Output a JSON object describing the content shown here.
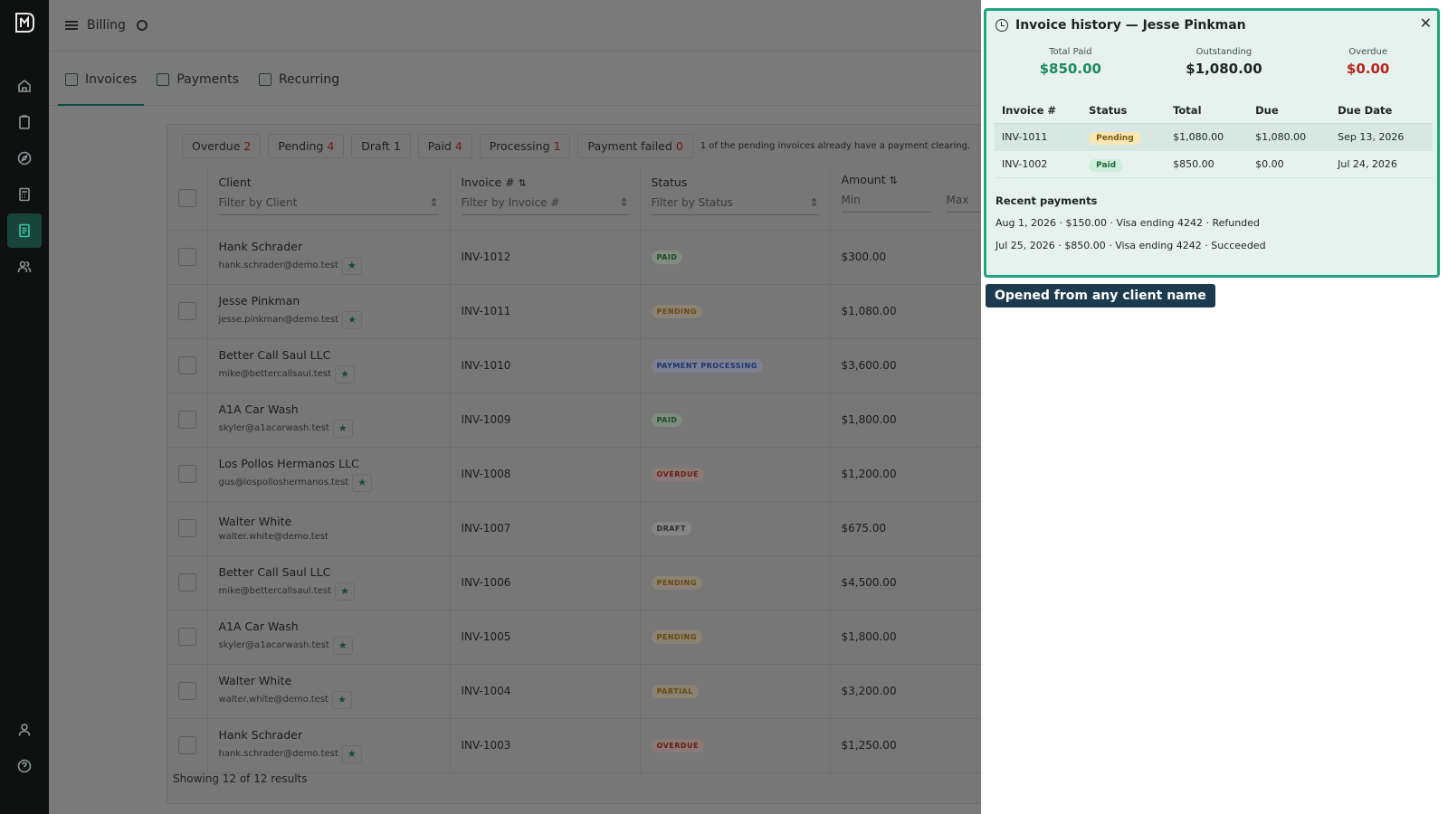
{
  "topbar": {
    "title": "Billing"
  },
  "tabs": [
    {
      "label": "Invoices",
      "active": true
    },
    {
      "label": "Payments",
      "active": false
    },
    {
      "label": "Recurring",
      "active": false
    }
  ],
  "filters": {
    "chips": [
      {
        "label": "Overdue",
        "count": "2"
      },
      {
        "label": "Pending",
        "count": "4"
      },
      {
        "label": "Draft",
        "count": "1"
      },
      {
        "label": "Paid",
        "count": "4"
      },
      {
        "label": "Processing",
        "count": "1"
      },
      {
        "label": "Payment failed",
        "count": "0"
      }
    ],
    "note": "1 of the pending invoices already have a payment clearing."
  },
  "table": {
    "columns": {
      "client": {
        "label": "Client",
        "filter": "Filter by Client"
      },
      "invoice": {
        "label": "Invoice #",
        "filter": "Filter by Invoice #"
      },
      "status": {
        "label": "Status",
        "filter": "Filter by Status"
      },
      "amount": {
        "label": "Amount",
        "filter_min": "Min",
        "filter_max": "Max"
      }
    },
    "rows": [
      {
        "client": "Hank Schrader",
        "email": "hank.schrader@demo.test",
        "starred": true,
        "invoice": "INV-1012",
        "status": "PAID",
        "status_kind": "paid",
        "amount": "$300.00"
      },
      {
        "client": "Jesse Pinkman",
        "email": "jesse.pinkman@demo.test",
        "starred": true,
        "invoice": "INV-1011",
        "status": "PENDING",
        "status_kind": "pending",
        "amount": "$1,080.00"
      },
      {
        "client": "Better Call Saul LLC",
        "email": "mike@bettercallsaul.test",
        "starred": true,
        "invoice": "INV-1010",
        "status": "PAYMENT PROCESSING",
        "status_kind": "processing",
        "amount": "$3,600.00"
      },
      {
        "client": "A1A Car Wash",
        "email": "skyler@a1acarwash.test",
        "starred": true,
        "invoice": "INV-1009",
        "status": "PAID",
        "status_kind": "paid",
        "amount": "$1,800.00"
      },
      {
        "client": "Los Pollos Hermanos LLC",
        "email": "gus@lospolloshermanos.test",
        "starred": true,
        "invoice": "INV-1008",
        "status": "OVERDUE",
        "status_kind": "overdue",
        "amount": "$1,200.00"
      },
      {
        "client": "Walter White",
        "email": "walter.white@demo.test",
        "starred": false,
        "invoice": "INV-1007",
        "status": "DRAFT",
        "status_kind": "draft",
        "amount": "$675.00"
      },
      {
        "client": "Better Call Saul LLC",
        "email": "mike@bettercallsaul.test",
        "starred": true,
        "invoice": "INV-1006",
        "status": "PENDING",
        "status_kind": "pending",
        "amount": "$4,500.00"
      },
      {
        "client": "A1A Car Wash",
        "email": "skyler@a1acarwash.test",
        "starred": true,
        "invoice": "INV-1005",
        "status": "PENDING",
        "status_kind": "pending",
        "amount": "$1,800.00"
      },
      {
        "client": "Walter White",
        "email": "walter.white@demo.test",
        "starred": true,
        "invoice": "INV-1004",
        "status": "PARTIAL",
        "status_kind": "partial",
        "amount": "$3,200.00"
      },
      {
        "client": "Hank Schrader",
        "email": "hank.schrader@demo.test",
        "starred": true,
        "invoice": "INV-1003",
        "status": "OVERDUE",
        "status_kind": "overdue",
        "amount": "$1,250.00"
      }
    ],
    "footer": "Showing 12 of 12 results"
  },
  "drawer": {
    "title": "Invoice history — Jesse Pinkman",
    "stats": [
      {
        "label": "Total Paid",
        "value": "$850.00",
        "color": "#1f8a5b"
      },
      {
        "label": "Outstanding",
        "value": "$1,080.00",
        "color": "#1d2522"
      },
      {
        "label": "Overdue",
        "value": "$0.00",
        "color": "#b3261e"
      }
    ],
    "history_headers": [
      "Invoice #",
      "Status",
      "Total",
      "Due",
      "Due Date"
    ],
    "history": [
      {
        "invoice": "INV-1011",
        "status": "Pending",
        "status_kind": "pending",
        "total": "$1,080.00",
        "due": "$1,080.00",
        "due_date": "Sep 13, 2026"
      },
      {
        "invoice": "INV-1002",
        "status": "Paid",
        "status_kind": "paid",
        "total": "$850.00",
        "due": "$0.00",
        "due_date": "Jul 24, 2026"
      }
    ],
    "recent_title": "Recent payments",
    "recent": [
      "Aug 1, 2026 · $150.00 · Visa ending 4242 · Refunded",
      "Jul 25, 2026 · $850.00 · Visa ending 4242 · Succeeded"
    ],
    "callout": "Opened from any client name"
  },
  "colors": {
    "accent": "#21a37f",
    "rail": "#0f1010",
    "callout": "#1d3b4f"
  }
}
